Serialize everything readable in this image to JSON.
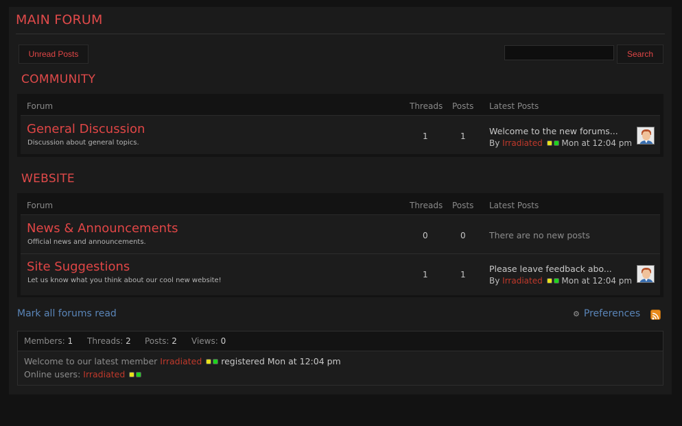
{
  "page": {
    "title": "MAIN FORUM"
  },
  "toolbar": {
    "unread_label": "Unread Posts",
    "search_placeholder": "",
    "search_label": "Search"
  },
  "table_headers": {
    "forum": "Forum",
    "threads": "Threads",
    "posts": "Posts",
    "latest": "Latest Posts"
  },
  "categories": [
    {
      "title": "COMMUNITY",
      "forums": [
        {
          "name": "General Discussion",
          "description": "Discussion about general topics.",
          "threads": "1",
          "posts": "1",
          "latest_title": "Welcome to the new forums...",
          "latest_by": "By",
          "latest_user": "Irradiated",
          "latest_time": "Mon at 12:04 pm"
        }
      ]
    },
    {
      "title": "WEBSITE",
      "forums": [
        {
          "name": "News & Announcements",
          "description": "Official news and announcements.",
          "threads": "0",
          "posts": "0",
          "no_posts": "There are no new posts"
        },
        {
          "name": "Site Suggestions",
          "description": "Let us know what you think about our cool new website!",
          "threads": "1",
          "posts": "1",
          "latest_title": "Please leave feedback abo...",
          "latest_by": "By",
          "latest_user": "Irradiated",
          "latest_time": "Mon at 12:04 pm"
        }
      ]
    }
  ],
  "footer": {
    "mark_read": "Mark all forums read",
    "preferences": "Preferences",
    "rss_icon": "rss-icon",
    "gear_icon": "gear-icon"
  },
  "stats": {
    "members_label": "Members:",
    "members": "1",
    "threads_label": "Threads:",
    "threads": "2",
    "posts_label": "Posts:",
    "posts": "2",
    "views_label": "Views:",
    "views": "0",
    "welcome_prefix": "Welcome to our latest member",
    "latest_member": "Irradiated",
    "registered": "registered Mon at 12:04 pm",
    "online_label": "Online users:",
    "online_user": "Irradiated"
  },
  "colors": {
    "accent": "#e14646",
    "link": "#5a85b8",
    "username": "#c0392b",
    "badge_yellow": "#e8e21a",
    "badge_green": "#1fd31f"
  }
}
